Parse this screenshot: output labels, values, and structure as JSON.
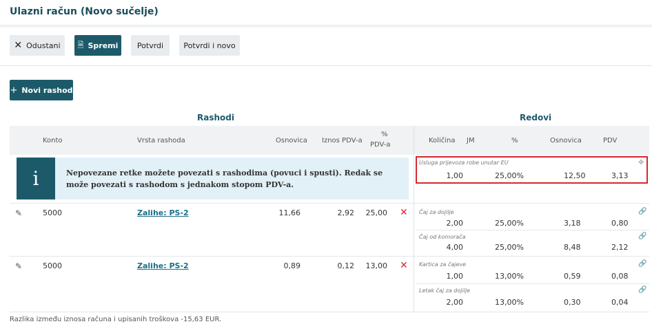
{
  "header": {
    "title": "Ulazni račun (Novo sučelje)"
  },
  "toolbar": {
    "cancel": "Odustani",
    "save": "Spremi",
    "confirm": "Potvrdi",
    "confirm_new": "Potvrdi i novo"
  },
  "new_expense_label": "Novi rashod",
  "sections": {
    "expenses": "Rashodi",
    "rows": "Redovi"
  },
  "columns_left": {
    "konto": "Konto",
    "vrsta": "Vrsta rashoda",
    "osnovica": "Osnovica",
    "iznos_pdv": "Iznos PDV-a",
    "pct_top": "%",
    "pct_bottom": "PDV-a"
  },
  "columns_right": {
    "kolicina": "Količina",
    "jm": "JM",
    "pct": "%",
    "osnovica": "Osnovica",
    "pdv": "PDV"
  },
  "info_text": "Nepovezane retke možete povezati s rashodima (povuci i spusti). Redak se može povezati s rashodom s jednakom stopom PDV-a.",
  "unlinked_row": {
    "name": "Usluga prijevoza robe unutar EU",
    "qty": "1,00",
    "pct": "25,00%",
    "base": "12,50",
    "vat": "3,13"
  },
  "expenses": [
    {
      "konto": "5000",
      "vrsta": "Zalihe: PS-2",
      "osnovica": "11,66",
      "iznos_pdv": "2,92",
      "pct": "25,00",
      "lines": [
        {
          "name": "Čaj za dojilje",
          "qty": "2,00",
          "pct": "25,00%",
          "base": "3,18",
          "vat": "0,80"
        },
        {
          "name": "Čaj od komorača",
          "qty": "4,00",
          "pct": "25,00%",
          "base": "8,48",
          "vat": "2,12"
        }
      ]
    },
    {
      "konto": "5000",
      "vrsta": "Zalihe: PS-2",
      "osnovica": "0,89",
      "iznos_pdv": "0,12",
      "pct": "13,00",
      "lines": [
        {
          "name": "Kartica za čajeve",
          "qty": "1,00",
          "pct": "13,00%",
          "base": "0,59",
          "vat": "0,08"
        },
        {
          "name": "Letak čaj za dojilje",
          "qty": "2,00",
          "pct": "13,00%",
          "base": "0,30",
          "vat": "0,04"
        }
      ]
    }
  ],
  "footer_note": "Razlika između iznosa računa i upisanih troškova -15,63 EUR."
}
